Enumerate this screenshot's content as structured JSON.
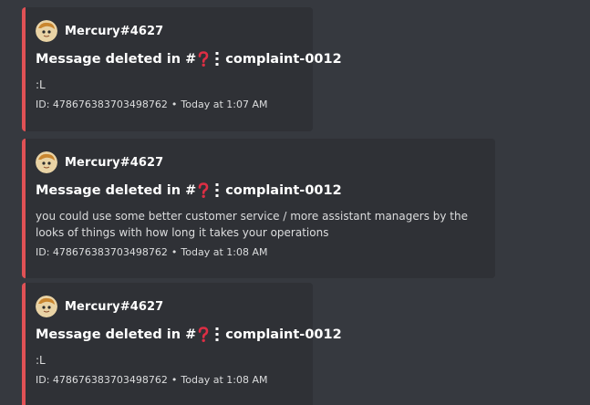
{
  "colors": {
    "background": "#36393f",
    "embed_background": "#2f3136",
    "embed_accent": "#e05155"
  },
  "messages": [
    {
      "author": "Mercury#4627",
      "title_prefix": "Message deleted in #",
      "channel": "complaint-0012",
      "description": ":L",
      "footer_id": "ID: 478676383703498762",
      "footer_separator": "•",
      "footer_time": "Today at 1:07 AM"
    },
    {
      "author": "Mercury#4627",
      "title_prefix": "Message deleted in #",
      "channel": "complaint-0012",
      "description": "you could use some better customer service / more assistant managers by the looks of things with how long it takes your operations",
      "footer_id": "ID: 478676383703498762",
      "footer_separator": "•",
      "footer_time": "Today at 1:08 AM"
    },
    {
      "author": "Mercury#4627",
      "title_prefix": "Message deleted in #",
      "channel": "complaint-0012",
      "description": ":L",
      "footer_id": "ID: 478676383703498762",
      "footer_separator": "•",
      "footer_time": "Today at 1:08 AM"
    }
  ]
}
